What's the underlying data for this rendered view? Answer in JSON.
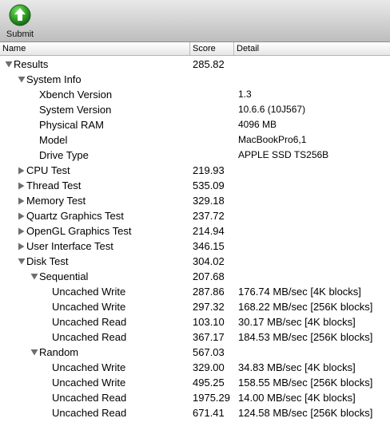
{
  "toolbar": {
    "submit_label": "Submit",
    "submit_icon": "green-up-arrow-icon",
    "accent": "#2e9e22"
  },
  "columns": {
    "name": "Name",
    "score": "Score",
    "detail": "Detail"
  },
  "rows": [
    {
      "name": "Results",
      "score": "285.82",
      "detail": "",
      "level": 0,
      "toggle": "open"
    },
    {
      "name": "System Info",
      "score": "",
      "detail": "",
      "level": 1,
      "toggle": "open"
    },
    {
      "name": "Xbench Version",
      "score": "",
      "detail": "1.3",
      "level": 2,
      "toggle": "none"
    },
    {
      "name": "System Version",
      "score": "",
      "detail": "10.6.6 (10J567)",
      "level": 2,
      "toggle": "none"
    },
    {
      "name": "Physical RAM",
      "score": "",
      "detail": "4096 MB",
      "level": 2,
      "toggle": "none"
    },
    {
      "name": "Model",
      "score": "",
      "detail": "MacBookPro6,1",
      "level": 2,
      "toggle": "none"
    },
    {
      "name": "Drive Type",
      "score": "",
      "detail": "APPLE SSD TS256B",
      "level": 2,
      "toggle": "none"
    },
    {
      "name": "CPU Test",
      "score": "219.93",
      "detail": "",
      "level": 1,
      "toggle": "closed"
    },
    {
      "name": "Thread Test",
      "score": "535.09",
      "detail": "",
      "level": 1,
      "toggle": "closed"
    },
    {
      "name": "Memory Test",
      "score": "329.18",
      "detail": "",
      "level": 1,
      "toggle": "closed"
    },
    {
      "name": "Quartz Graphics Test",
      "score": "237.72",
      "detail": "",
      "level": 1,
      "toggle": "closed"
    },
    {
      "name": "OpenGL Graphics Test",
      "score": "214.94",
      "detail": "",
      "level": 1,
      "toggle": "closed"
    },
    {
      "name": "User Interface Test",
      "score": "346.15",
      "detail": "",
      "level": 1,
      "toggle": "closed"
    },
    {
      "name": "Disk Test",
      "score": "304.02",
      "detail": "",
      "level": 1,
      "toggle": "open"
    },
    {
      "name": "Sequential",
      "score": "207.68",
      "detail": "",
      "level": 2,
      "toggle": "open"
    },
    {
      "name": "Uncached Write",
      "score": "287.86",
      "detail": "176.74 MB/sec [4K blocks]",
      "level": 3,
      "toggle": "none"
    },
    {
      "name": "Uncached Write",
      "score": "297.32",
      "detail": "168.22 MB/sec [256K blocks]",
      "level": 3,
      "toggle": "none"
    },
    {
      "name": "Uncached Read",
      "score": "103.10",
      "detail": "30.17 MB/sec [4K blocks]",
      "level": 3,
      "toggle": "none"
    },
    {
      "name": "Uncached Read",
      "score": "367.17",
      "detail": "184.53 MB/sec [256K blocks]",
      "level": 3,
      "toggle": "none"
    },
    {
      "name": "Random",
      "score": "567.03",
      "detail": "",
      "level": 2,
      "toggle": "open"
    },
    {
      "name": "Uncached Write",
      "score": "329.00",
      "detail": "34.83 MB/sec [4K blocks]",
      "level": 3,
      "toggle": "none"
    },
    {
      "name": "Uncached Write",
      "score": "495.25",
      "detail": "158.55 MB/sec [256K blocks]",
      "level": 3,
      "toggle": "none"
    },
    {
      "name": "Uncached Read",
      "score": "1975.29",
      "detail": "14.00 MB/sec [4K blocks]",
      "level": 3,
      "toggle": "none"
    },
    {
      "name": "Uncached Read",
      "score": "671.41",
      "detail": "124.58 MB/sec [256K blocks]",
      "level": 3,
      "toggle": "none"
    }
  ]
}
